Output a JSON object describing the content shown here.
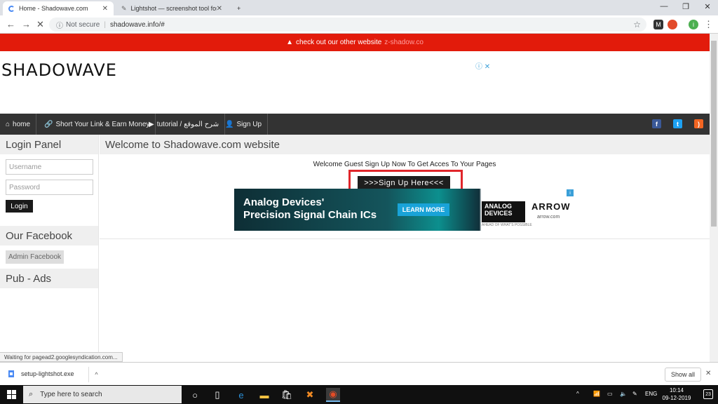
{
  "browser": {
    "tabs": [
      {
        "title": "Home - Shadowave.com",
        "active": true
      },
      {
        "title": "Lightshot — screenshot tool for M",
        "active": false
      }
    ],
    "new_tab": "+",
    "security": "Not secure",
    "url": "shadowave.info/#",
    "profile_initial": "i"
  },
  "site": {
    "alert": {
      "icon": "warning-icon",
      "text": "check out our other website",
      "link": "z-shadow.co"
    },
    "logo": "SHADOWAVE",
    "nav": [
      {
        "icon": "home-icon",
        "label": "home"
      },
      {
        "icon": "link-icon",
        "label": "Short Your Link & Earn Money"
      },
      {
        "icon": "youtube-icon",
        "label": "tutorial / شرح الموقع"
      },
      {
        "icon": "user-plus-icon",
        "label": "Sign Up"
      }
    ],
    "social": [
      "facebook-icon",
      "twitter-icon",
      "rss-icon"
    ],
    "sidebar": {
      "login_title": "Login Panel",
      "username_placeholder": "Username",
      "password_placeholder": "Password",
      "login_button": "Login",
      "facebook_title": "Our Facebook",
      "facebook_button": "Admin Facebook",
      "ads_title": "Pub - Ads"
    },
    "main": {
      "title": "Welcome to Shadowave.com website",
      "welcome": "Welcome Guest Sign Up Now To Get Acces To Your Pages",
      "signup_button": ">>>Sign Up Here<<<"
    },
    "ad": {
      "headline1": "Analog Devices'",
      "headline2": "Precision Signal Chain ICs",
      "cta": "LEARN MORE",
      "brand1": "ANALOG DEVICES",
      "brand1_tag": "AHEAD OF WHAT'S POSSIBLE",
      "brand2": "ARROW",
      "brand2_url": "arrow.com"
    }
  },
  "status": "Waiting for pagead2.googlesyndication.com...",
  "downloads": {
    "file": "setup-lightshot.exe",
    "show_all": "Show all"
  },
  "taskbar": {
    "search_placeholder": "Type here to search",
    "lang": "ENG",
    "time": "10:14",
    "date": "09-12-2019",
    "notifications": "23"
  },
  "colors": {
    "alert_bar": "#e21b0b",
    "nav_bar": "#333333",
    "highlight": "#e0262b",
    "facebook": "#3b5998",
    "twitter": "#1da1f2",
    "rss": "#f26522"
  }
}
